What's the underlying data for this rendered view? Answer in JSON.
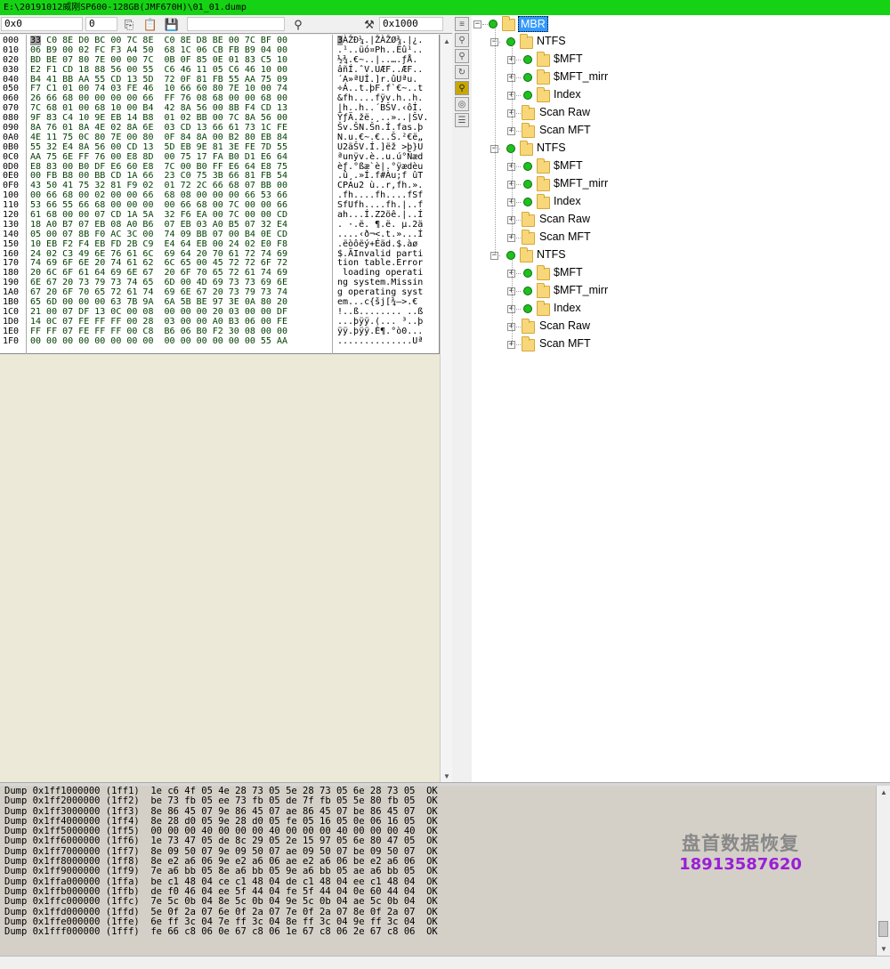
{
  "window": {
    "title": "E:\\20191012威刚SP600-128GB(JMF670H)\\01_01.dump"
  },
  "hex_toolbar": {
    "offset_value": "0x0",
    "value_field": "0",
    "length_value": "0x1000",
    "copy_icon": "copy-icon",
    "paste_icon": "paste-icon",
    "save_icon": "save-icon",
    "find_icon": "binoculars-icon",
    "tools_icon": "tools-icon"
  },
  "hex_view": {
    "offsets": [
      "000",
      "010",
      "020",
      "030",
      "040",
      "050",
      "060",
      "070",
      "080",
      "090",
      "0A0",
      "0B0",
      "0C0",
      "0D0",
      "0E0",
      "0F0",
      "100",
      "110",
      "120",
      "130",
      "140",
      "150",
      "160",
      "170",
      "180",
      "190",
      "1A0",
      "1B0",
      "1C0",
      "1D0",
      "1E0",
      "1F0"
    ],
    "first_byte": "33",
    "rows": [
      " C0 8E D0 BC 00 7C 8E  C0 8E D8 BE 00 7C BF 00",
      "06 B9 00 02 FC F3 A4 50  68 1C 06 CB FB B9 04 00",
      "BD BE 07 80 7E 00 00 7C  0B 0F 85 0E 01 83 C5 10",
      "E2 F1 CD 18 88 56 00 55  C6 46 11 05 C6 46 10 00",
      "B4 41 BB AA 55 CD 13 5D  72 0F 81 FB 55 AA 75 09",
      "F7 C1 01 00 74 03 FE 46  10 66 60 80 7E 10 00 74",
      "26 66 68 00 00 00 00 66  FF 76 08 68 00 00 68 00",
      "7C 68 01 00 68 10 00 B4  42 8A 56 00 8B F4 CD 13",
      "9F 83 C4 10 9E EB 14 B8  01 02 BB 00 7C 8A 56 00",
      "8A 76 01 8A 4E 02 8A 6E  03 CD 13 66 61 73 1C FE",
      "4E 11 75 0C 80 7E 00 80  0F 84 8A 00 B2 80 EB 84",
      "55 32 E4 8A 56 00 CD 13  5D EB 9E 81 3E FE 7D 55",
      "AA 75 6E FF 76 00 E8 8D  00 75 17 FA B0 D1 E6 64",
      "E8 83 00 B0 DF E6 60 E8  7C 00 B0 FF E6 64 E8 75",
      "00 FB B8 00 BB CD 1A 66  23 C0 75 3B 66 81 FB 54",
      "43 50 41 75 32 81 F9 02  01 72 2C 66 68 07 BB 00",
      "00 66 68 00 02 00 00 66  68 08 00 00 00 66 53 66",
      "53 66 55 66 68 00 00 00  00 66 68 00 7C 00 00 66",
      "61 68 00 00 07 CD 1A 5A  32 F6 EA 00 7C 00 00 CD",
      "18 A0 B7 07 EB 08 A0 B6  07 EB 03 A0 B5 07 32 E4",
      "05 00 07 8B F0 AC 3C 00  74 09 BB 07 00 B4 0E CD",
      "10 EB F2 F4 EB FD 2B C9  E4 64 EB 00 24 02 E0 F8",
      "24 02 C3 49 6E 76 61 6C  69 64 20 70 61 72 74 69",
      "74 69 6F 6E 20 74 61 62  6C 65 00 45 72 72 6F 72",
      "20 6C 6F 61 64 69 6E 67  20 6F 70 65 72 61 74 69",
      "6E 67 20 73 79 73 74 65  6D 00 4D 69 73 73 69 6E",
      "67 20 6F 70 65 72 61 74  69 6E 67 20 73 79 73 74",
      "65 6D 00 00 00 63 7B 9A  6A 5B BE 97 3E 0A 80 20",
      "21 00 07 DF 13 0C 00 08  00 00 00 20 03 00 00 DF",
      "14 0C 07 FE FF FF 00 28  03 00 00 A0 B3 06 00 FE",
      "FF FF 07 FE FF FF 00 C8  B6 06 B0 F2 30 08 00 00",
      "00 00 00 00 00 00 00 00  00 00 00 00 00 00 55 AA"
    ],
    "ascii_first": "3",
    "ascii_rows": [
      "ÀŽÐ¼.|ŽÀŽØ¾.|¿.",
      ".¹..üó¤Ph..Ëû¹..",
      "½¾.€~..|..….ƒÅ.",
      "âñÍ.ˆV.UÆF..ÆF..",
      "´A»ªUÍ.]r.ûUªu.",
      "÷Á..t.þF.f`€~..t",
      "&fh....fÿv.h..h.",
      "|h..h..´BŠV.‹ôÍ.",
      "ŸƒÄ.žë.¸..»..|ŠV.",
      "Šv.ŠN.Šn.Í.fas.þ",
      "N.u.€~.€..Š.²€ë„",
      "U2äŠV.Í.]ëž >þ}U",
      "ªunÿv.è..u.ú°Ñæd",
      "èƒ.°ßæ`è|.°ÿædèu",
      ".û¸.»Í.f#Àu;f ûT",
      "CPAu2 ù..r,fh.».",
      ".fh....fh....fSf",
      "SfUfh....fh.|..f",
      "ah...Í.Z2öê.|..Í",
      ". ·.ë. ¶.ë. µ.2ä",
      "....‹ð¬<.t.»...Í",
      ".ëòôëý+Éäd.$.àø",
      "$.ÃInvalid parti",
      "tion table.Error",
      " loading operati",
      "ng system.Missin",
      "g operating syst",
      "em...c{šj[¾—>.€ ",
      "!..ß........ ..ß",
      "...þÿÿ.(... ³..þ",
      "ÿÿ.þÿÿ.È¶.°ò0...",
      "..............Uª"
    ]
  },
  "side_icons": [
    "list-icon",
    "pin-icon",
    "pin-icon",
    "refresh-icon",
    "pin-icon",
    "eye-icon",
    "notes-icon"
  ],
  "tree": {
    "root": "MBR",
    "partitions": [
      {
        "label": "NTFS",
        "children": [
          "$MFT",
          "$MFT_mirr",
          "Index",
          "Scan Raw",
          "Scan MFT"
        ]
      },
      {
        "label": "NTFS",
        "children": [
          "$MFT",
          "$MFT_mirr",
          "Index",
          "Scan Raw",
          "Scan MFT"
        ]
      },
      {
        "label": "NTFS",
        "children": [
          "$MFT",
          "$MFT_mirr",
          "Index",
          "Scan Raw",
          "Scan MFT"
        ]
      }
    ]
  },
  "log": {
    "lines": [
      "Dump 0x1ff1000000 (1ff1)  1e c6 4f 05 4e 28 73 05 5e 28 73 05 6e 28 73 05  OK",
      "Dump 0x1ff2000000 (1ff2)  be 73 fb 05 ee 73 fb 05 de 7f fb 05 5e 80 fb 05  OK",
      "Dump 0x1ff3000000 (1ff3)  8e 86 45 07 9e 86 45 07 ae 86 45 07 be 86 45 07  OK",
      "Dump 0x1ff4000000 (1ff4)  8e 28 d0 05 9e 28 d0 05 fe 05 16 05 0e 06 16 05  OK",
      "Dump 0x1ff5000000 (1ff5)  00 00 00 40 00 00 00 40 00 00 00 40 00 00 00 40  OK",
      "Dump 0x1ff6000000 (1ff6)  1e 73 47 05 de 8c 29 05 2e 15 97 05 6e 80 47 05  OK",
      "Dump 0x1ff7000000 (1ff7)  8e 09 50 07 9e 09 50 07 ae 09 50 07 be 09 50 07  OK",
      "Dump 0x1ff8000000 (1ff8)  8e e2 a6 06 9e e2 a6 06 ae e2 a6 06 be e2 a6 06  OK",
      "Dump 0x1ff9000000 (1ff9)  7e a6 bb 05 8e a6 bb 05 9e a6 bb 05 ae a6 bb 05  OK",
      "Dump 0x1ffa000000 (1ffa)  be c1 48 04 ce c1 48 04 de c1 48 04 ee c1 48 04  OK",
      "Dump 0x1ffb000000 (1ffb)  de f0 46 04 ee 5f 44 04 fe 5f 44 04 0e 60 44 04  OK",
      "Dump 0x1ffc000000 (1ffc)  7e 5c 0b 04 8e 5c 0b 04 9e 5c 0b 04 ae 5c 0b 04  OK",
      "Dump 0x1ffd000000 (1ffd)  5e 0f 2a 07 6e 0f 2a 07 7e 0f 2a 07 8e 0f 2a 07  OK",
      "Dump 0x1ffe000000 (1ffe)  6e ff 3c 04 7e ff 3c 04 8e ff 3c 04 9e ff 3c 04  OK",
      "Dump 0x1fff000000 (1fff)  fe 66 c8 06 0e 67 c8 06 1e 67 c8 06 2e 67 c8 06  OK"
    ]
  },
  "watermark": {
    "line1": "盘首数据恢复",
    "line2": "18913587620"
  },
  "colors": {
    "titlebar": "#16d214",
    "hex_bytes": "#004000",
    "selection": "#3399ff",
    "status_dot": "#1fc01f",
    "watermark_phone": "#9b1fd6"
  }
}
